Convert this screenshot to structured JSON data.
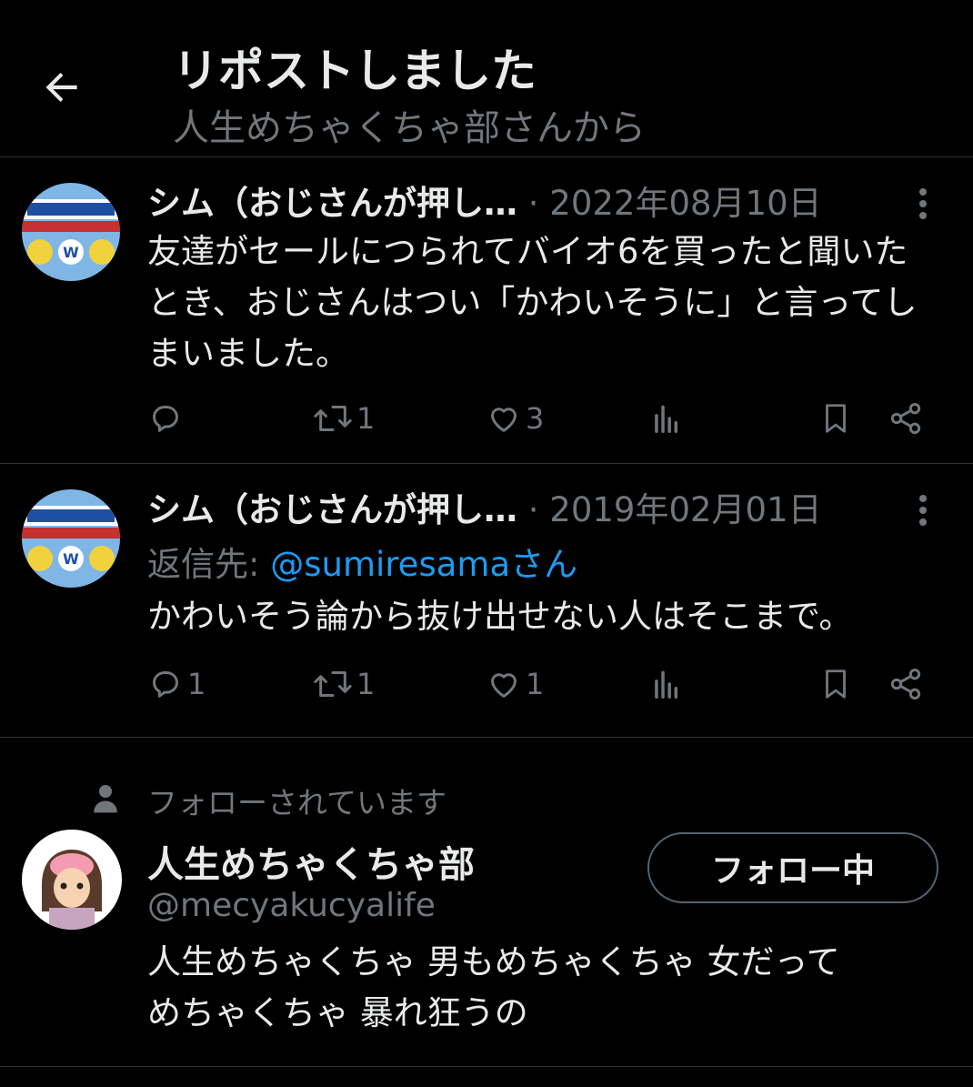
{
  "header": {
    "title": "リポストしました",
    "subtitle": "人生めちゃくちゃ部さんから"
  },
  "posts": [
    {
      "author": "シム（おじさんが押し…",
      "dot": "·",
      "date": "2022年08月10日",
      "text": "友達がセールにつられてバイオ6を買ったと聞いたとき、おじさんはつい「かわいそうに」と言ってしまいました。",
      "counts": {
        "reply": "",
        "repost": "1",
        "like": "3"
      }
    },
    {
      "author": "シム（おじさんが押し…",
      "dot": "·",
      "date": "2019年02月01日",
      "reply_prefix": "返信先: ",
      "reply_handle": "@sumiresamaさん",
      "text": "かわいそう論から抜け出せない人はそこまで。",
      "counts": {
        "reply": "1",
        "repost": "1",
        "like": "1"
      }
    }
  ],
  "follow": {
    "label": "フォローされています",
    "name": "人生めちゃくちゃ部",
    "handle": "@mecyakucyalife",
    "button": "フォロー中",
    "bio_line1": "人生めちゃくちゃ 男もめちゃくちゃ 女だって",
    "bio_line2": "めちゃくちゃ 暴れ狂うの"
  },
  "icons": [
    "back-arrow-icon",
    "more-icon",
    "reply-icon",
    "repost-icon",
    "like-icon",
    "views-icon",
    "bookmark-icon",
    "share-icon",
    "person-icon"
  ],
  "colors": {
    "background": "#000000",
    "text": "#e7e9ea",
    "muted": "#71767b",
    "link": "#1d9bf0",
    "border": "#2f3336"
  }
}
